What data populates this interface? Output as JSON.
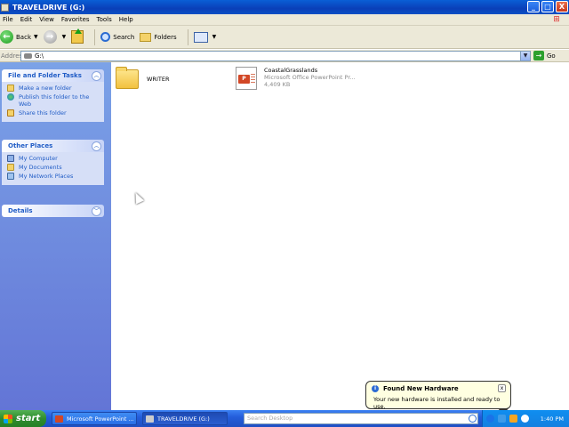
{
  "window": {
    "title": "TRAVELDRIVE (G:)",
    "buttons": {
      "minimize": "_",
      "maximize": "□",
      "close": "X"
    }
  },
  "menu": [
    "File",
    "Edit",
    "View",
    "Favorites",
    "Tools",
    "Help"
  ],
  "toolbar": {
    "back": "Back",
    "search": "Search",
    "folders": "Folders"
  },
  "address": {
    "label": "Address",
    "value": "G:\\",
    "go": "Go"
  },
  "sidebar": {
    "file_folder_tasks": {
      "title": "File and Folder Tasks",
      "items": [
        "Make a new folder",
        "Publish this folder to the Web",
        "Share this folder"
      ]
    },
    "other_places": {
      "title": "Other Places",
      "items": [
        "My Computer",
        "My Documents",
        "My Network Places"
      ]
    },
    "details": {
      "title": "Details"
    }
  },
  "files": [
    {
      "name": "WRITER",
      "type": "folder"
    },
    {
      "name": "CoastalGrasslands",
      "type": "Microsoft Office PowerPoint Pr...",
      "size": "4,409 KB"
    }
  ],
  "balloon": {
    "title": "Found New Hardware",
    "text": "Your new hardware is installed and ready to use."
  },
  "taskbar": {
    "start": "start",
    "items": [
      "Microsoft PowerPoint ...",
      "TRAVELDRIVE (G:)"
    ],
    "search_placeholder": "Search Desktop",
    "clock": "1:40 PM"
  },
  "icons": {
    "accent": "#215dc6",
    "taskbar": "#245edb",
    "start": "#2f8c2f"
  }
}
